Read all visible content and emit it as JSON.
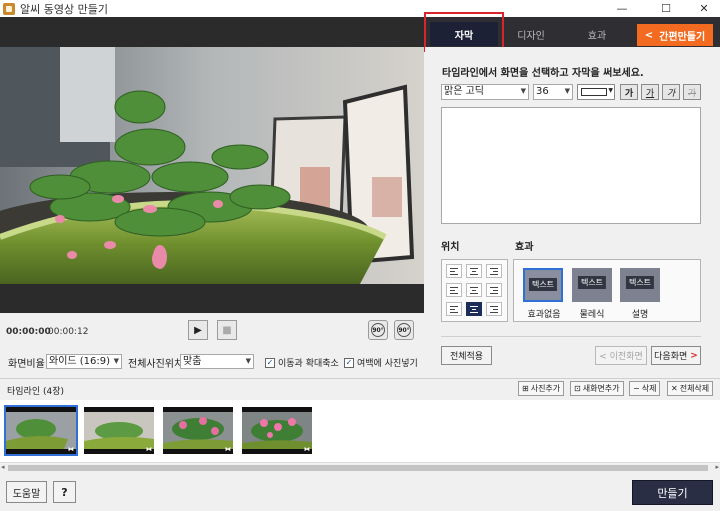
{
  "window": {
    "title": "알씨 동영상 만들기",
    "minimize": "—",
    "maximize": "☐",
    "close": "✕"
  },
  "player": {
    "current_time": "00:00:00",
    "total_time": "00:00:12",
    "play_icon": "▶",
    "stop_icon": "■",
    "rotate_left_label": "90°",
    "rotate_right_label": "90°"
  },
  "settings": {
    "ratio_label": "화면비율",
    "ratio_value": "와이드 (16:9)",
    "photo_pos_label": "전체사진위치",
    "photo_pos_value": "맞춤",
    "move_zoom_label": "이동과 확대축소",
    "move_zoom_checked": true,
    "fill_margin_label": "여백에 사진넣기",
    "fill_margin_checked": true
  },
  "tabs": [
    {
      "label": "자막",
      "active": true
    },
    {
      "label": "디자인",
      "active": false
    },
    {
      "label": "효과",
      "active": false
    }
  ],
  "easy_make": {
    "icon": "<",
    "label": "간편만들기"
  },
  "caption": {
    "instruction": "타임라인에서 화면을 선택하고 자막을 써보세요.",
    "font": "맑은 고딕",
    "size": "36",
    "format_buttons": [
      "가",
      "가",
      "가",
      "가"
    ],
    "text": ""
  },
  "position": {
    "title": "위치",
    "selected_index": 7
  },
  "effect": {
    "title": "효과",
    "items": [
      {
        "chip": "텍스트",
        "label": "효과없음",
        "selected": true
      },
      {
        "chip": "텍스트",
        "label": "물레식",
        "selected": false
      },
      {
        "chip": "텍스트",
        "label": "설명",
        "selected": false
      }
    ]
  },
  "actions": {
    "apply_all": "전체적용",
    "prev": "< 이전화면",
    "next": "다음화면",
    "next_icon": ">"
  },
  "timeline": {
    "title": "타임라인 (4장)",
    "add_photo": "사진추가",
    "add_new_screen": "새화면추가",
    "delete": "삭제",
    "delete_all": "전체삭제",
    "thumbnail_mark": "⧓"
  },
  "bottom": {
    "help": "도움말",
    "question": "?",
    "make": "만들기"
  },
  "colors": {
    "accent": "#f26b21",
    "dark_navy": "#1c2135",
    "selection_blue": "#2f6fd6",
    "highlight_red": "#d9242b"
  }
}
